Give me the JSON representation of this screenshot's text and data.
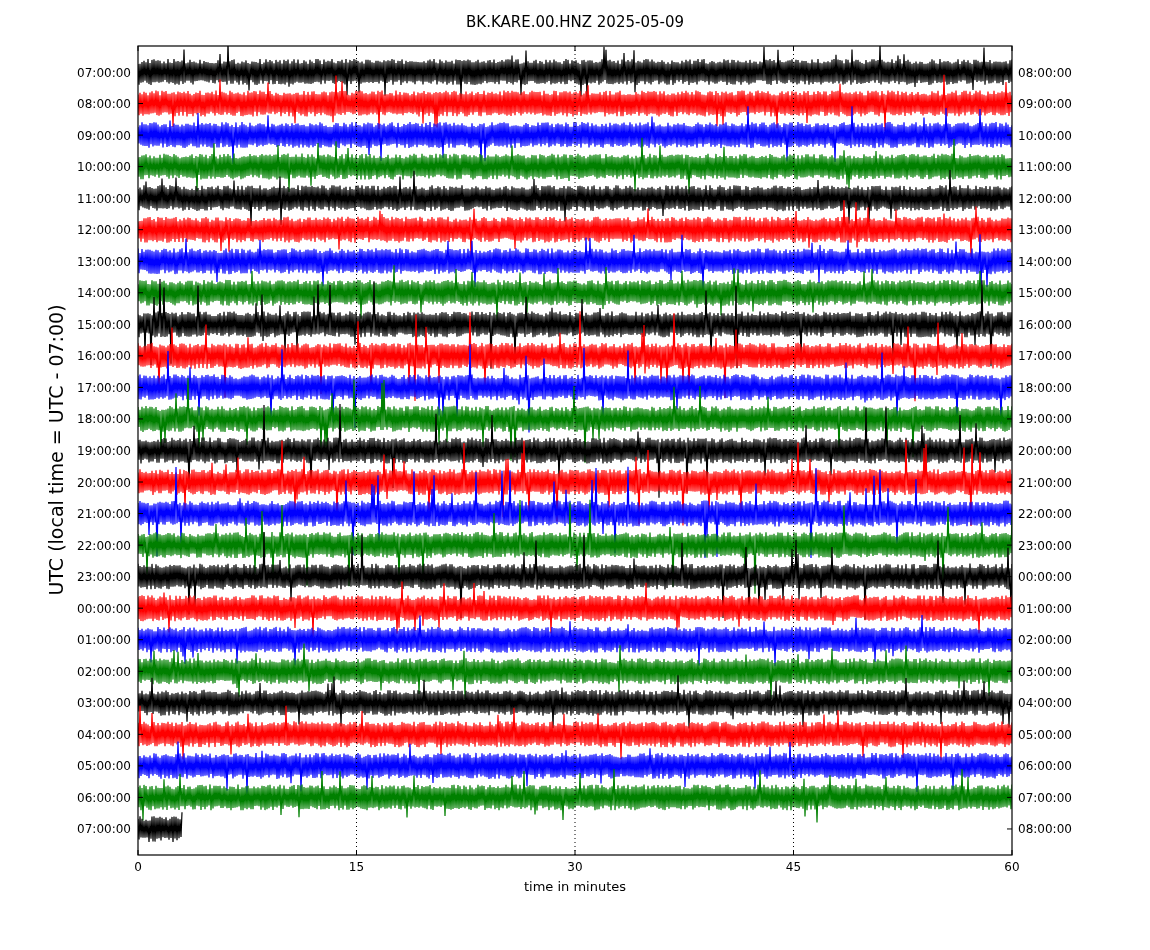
{
  "figure": {
    "title": "BK.KARE.00.HNZ 2025-05-09",
    "ylabel": "UTC (local time = UTC - 07:00)",
    "xlabel": "time in minutes",
    "xticks": [
      "0",
      "15",
      "30",
      "45",
      "60"
    ],
    "left_labels": [
      "07:00:00",
      "08:00:00",
      "09:00:00",
      "10:00:00",
      "11:00:00",
      "12:00:00",
      "13:00:00",
      "14:00:00",
      "15:00:00",
      "16:00:00",
      "17:00:00",
      "18:00:00",
      "19:00:00",
      "20:00:00",
      "21:00:00",
      "22:00:00",
      "23:00:00",
      "00:00:00",
      "01:00:00",
      "02:00:00",
      "03:00:00",
      "04:00:00",
      "05:00:00",
      "06:00:00",
      "07:00:00"
    ],
    "right_labels": [
      "08:00:00",
      "09:00:00",
      "10:00:00",
      "11:00:00",
      "12:00:00",
      "13:00:00",
      "14:00:00",
      "15:00:00",
      "16:00:00",
      "17:00:00",
      "18:00:00",
      "19:00:00",
      "20:00:00",
      "21:00:00",
      "22:00:00",
      "23:00:00",
      "00:00:00",
      "01:00:00",
      "02:00:00",
      "03:00:00",
      "04:00:00",
      "05:00:00",
      "06:00:00",
      "07:00:00",
      "08:00:00"
    ],
    "traces": [
      {
        "color": "#000000",
        "level": 1
      },
      {
        "color": "#ff0000",
        "level": 1
      },
      {
        "color": "#0000ff",
        "level": 1
      },
      {
        "color": "#008000",
        "level": 1
      },
      {
        "color": "#000000",
        "level": 1
      },
      {
        "color": "#ff0000",
        "level": 1
      },
      {
        "color": "#0000ff",
        "level": 1
      },
      {
        "color": "#008000",
        "level": 1
      },
      {
        "color": "#000000",
        "level": 1
      },
      {
        "color": "#ff0000",
        "level": 1
      },
      {
        "color": "#0000ff",
        "level": 1
      },
      {
        "color": "#008000",
        "level": 1
      },
      {
        "color": "#000000",
        "level": 1
      },
      {
        "color": "#ff0000",
        "level": 1
      },
      {
        "color": "#0000ff",
        "level": 1
      },
      {
        "color": "#008000",
        "level": 1
      },
      {
        "color": "#000000",
        "level": 1
      },
      {
        "color": "#ff0000",
        "level": 1
      },
      {
        "color": "#0000ff",
        "level": 1
      },
      {
        "color": "#008000",
        "level": 1
      },
      {
        "color": "#000000",
        "level": 1
      },
      {
        "color": "#ff0000",
        "level": 1
      },
      {
        "color": "#0000ff",
        "level": 1
      },
      {
        "color": "#008000",
        "level": 1
      },
      {
        "color": "#000000",
        "level": 0.05
      }
    ]
  }
}
